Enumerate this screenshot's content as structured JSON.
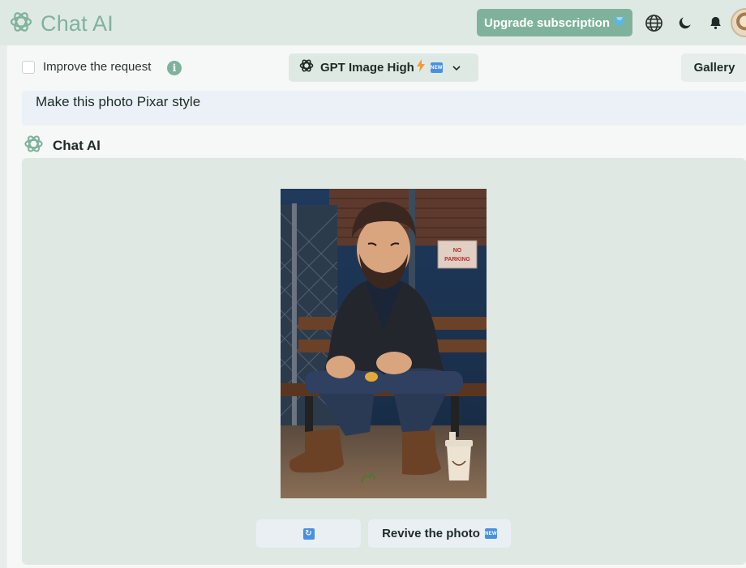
{
  "header": {
    "brand": "Chat AI",
    "upgrade_label": "Upgrade subscription",
    "upgrade_icon": "diamond-icon",
    "icons": [
      "globe-icon",
      "moon-icon",
      "bell-icon"
    ]
  },
  "options": {
    "improve_label": "Improve the request",
    "improve_checked": false,
    "info_icon": "i",
    "model": "GPT Image High",
    "model_badge": "NEW",
    "gallery_label": "Gallery"
  },
  "conversation": {
    "user_message": "Make this photo Pixar style",
    "assistant_name": "Chat AI",
    "actions": {
      "refresh_icon": "refresh-icon",
      "revive_label": "Revive the photo",
      "revive_badge": "NEW"
    },
    "image": {
      "sign_line1": "NO",
      "sign_line2": "PARKING"
    }
  },
  "colors": {
    "accent": "#7fb29c",
    "topbar": "#dfe9e4",
    "card": "#dfe8e3",
    "badge": "#4a90e2"
  }
}
